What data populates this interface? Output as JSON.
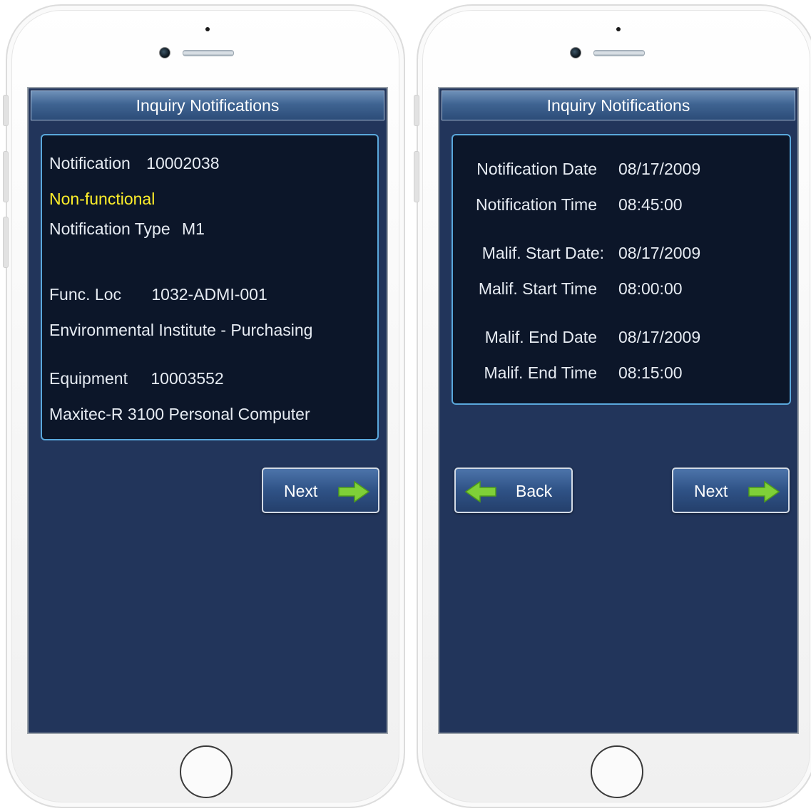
{
  "colors": {
    "screen_bg": "#22355b",
    "card_bg": "#0c1629",
    "card_border": "#5aa8dc",
    "status_text": "#ffef2a",
    "arrow_green": "#7fd038"
  },
  "phone_left": {
    "title": "Inquiry Notifications",
    "notification_label": "Notification",
    "notification_value": "10002038",
    "status": "Non-functional",
    "notification_type_label": "Notification Type",
    "notification_type_value": "M1",
    "func_loc_label": "Func. Loc",
    "func_loc_value": "1032-ADMI-001",
    "func_loc_description": "Environmental Institute - Purchasing",
    "equipment_label": "Equipment",
    "equipment_value": "10003552",
    "equipment_description": "Maxitec-R 3100 Personal Computer",
    "next_label": "Next",
    "next_icon": "arrow-right-icon"
  },
  "phone_right": {
    "title": "Inquiry Notifications",
    "rows": [
      {
        "label": "Notification Date",
        "value": "08/17/2009"
      },
      {
        "label": "Notification Time",
        "value": "08:45:00"
      },
      {
        "label": "Malif. Start Date:",
        "value": "08/17/2009"
      },
      {
        "label": "Malif. Start Time",
        "value": "08:00:00"
      },
      {
        "label": "Malif. End Date",
        "value": "08/17/2009"
      },
      {
        "label": "Malif. End Time",
        "value": "08:15:00"
      }
    ],
    "back_label": "Back",
    "back_icon": "arrow-left-icon",
    "next_label": "Next",
    "next_icon": "arrow-right-icon"
  }
}
